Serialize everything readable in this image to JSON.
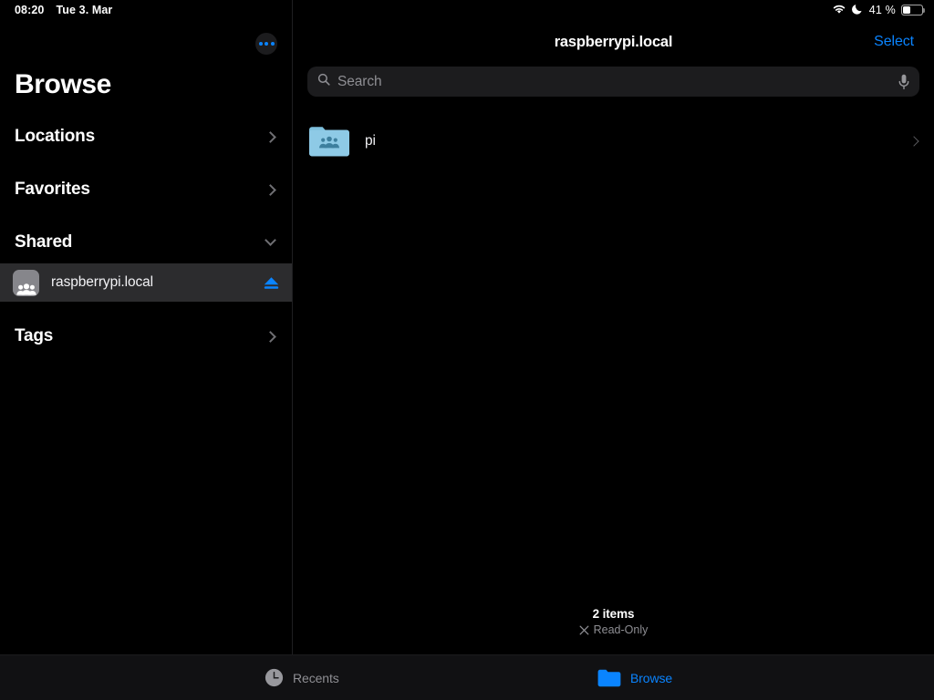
{
  "status_bar": {
    "time": "08:20",
    "date": "Tue 3. Mar",
    "wifi_icon": "wifi-icon",
    "dnd_icon": "crescent-moon-icon",
    "battery_percent": "41 %",
    "battery_icon": "battery-icon",
    "battery_level": 41
  },
  "sidebar": {
    "more_button": "more-ellipsis-button",
    "title": "Browse",
    "sections": [
      {
        "label": "Locations",
        "disclosure": "chevron-right-icon",
        "expanded": false
      },
      {
        "label": "Favorites",
        "disclosure": "chevron-right-icon",
        "expanded": false
      },
      {
        "label": "Shared",
        "disclosure": "chevron-down-icon",
        "expanded": true
      },
      {
        "label": "Tags",
        "disclosure": "chevron-right-icon",
        "expanded": false
      }
    ],
    "shared_items": [
      {
        "name": "raspberrypi.local",
        "icon": "group-people-icon",
        "selected": true,
        "action_icon": "eject-icon"
      }
    ]
  },
  "content": {
    "nav": {
      "title": "raspberrypi.local",
      "select_label": "Select"
    },
    "search": {
      "placeholder": "Search",
      "value": "",
      "search_icon": "magnifier-icon",
      "dictation_icon": "microphone-icon"
    },
    "items": [
      {
        "name": "pi",
        "icon": "shared-folder-icon",
        "disclosure": "chevron-right-icon"
      }
    ],
    "footer": {
      "count": "2 items",
      "permission": "Read-Only",
      "permission_icon": "no-edit-x-icon"
    }
  },
  "tab_bar": {
    "tabs": [
      {
        "label": "Recents",
        "icon": "clock-icon",
        "active": false
      },
      {
        "label": "Browse",
        "icon": "folder-icon",
        "active": true
      }
    ]
  },
  "colors": {
    "accent": "#0a84ff",
    "background": "#000000",
    "sidebar_selected": "#2c2c2e",
    "search_field": "#1c1c1e",
    "secondary_text": "#8e8e93",
    "folder_blue": "#8ecae6"
  }
}
